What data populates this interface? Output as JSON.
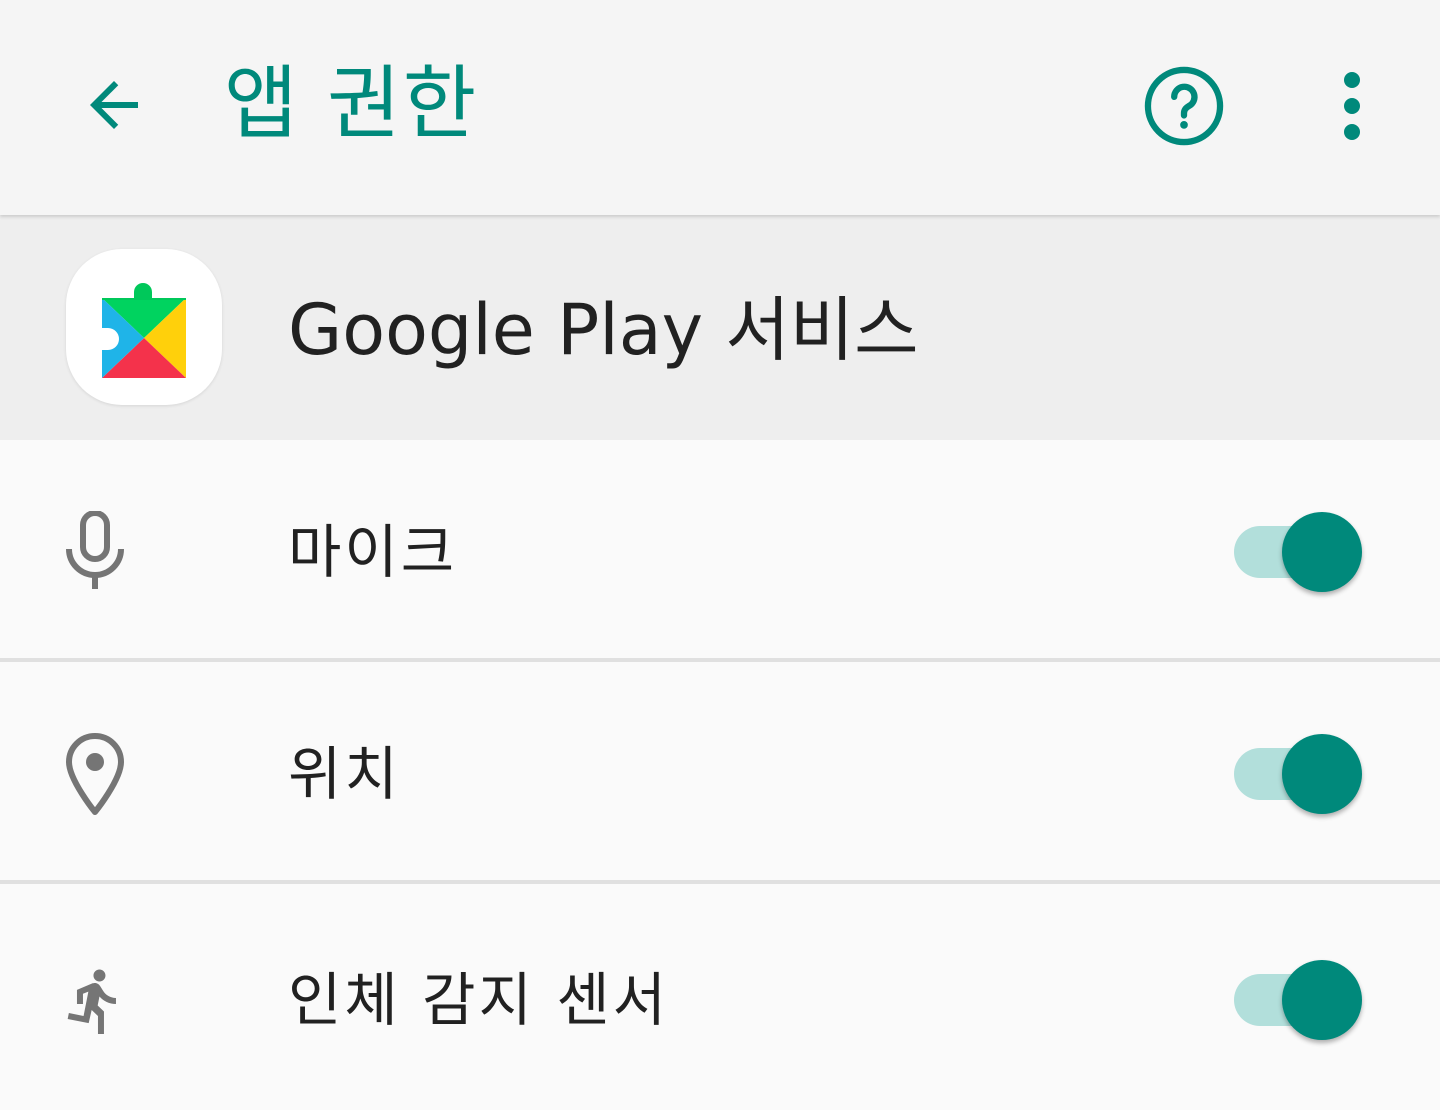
{
  "colors": {
    "accent": "#00897b",
    "switch_track": "#b2dfdb",
    "text_primary": "#212121",
    "icon_gray": "#757575"
  },
  "appbar": {
    "title": "앱 권한",
    "back_icon": "arrow-back-icon",
    "help_icon": "help-circle-icon",
    "more_icon": "more-vert-icon"
  },
  "app": {
    "name": "Google Play 서비스",
    "icon": "google-play-services-logo"
  },
  "permissions": [
    {
      "label": "마이크",
      "icon": "mic-icon",
      "enabled": true
    },
    {
      "label": "위치",
      "icon": "location-pin-icon",
      "enabled": true
    },
    {
      "label": "인체 감지 센서",
      "icon": "walking-person-icon",
      "enabled": true
    }
  ]
}
